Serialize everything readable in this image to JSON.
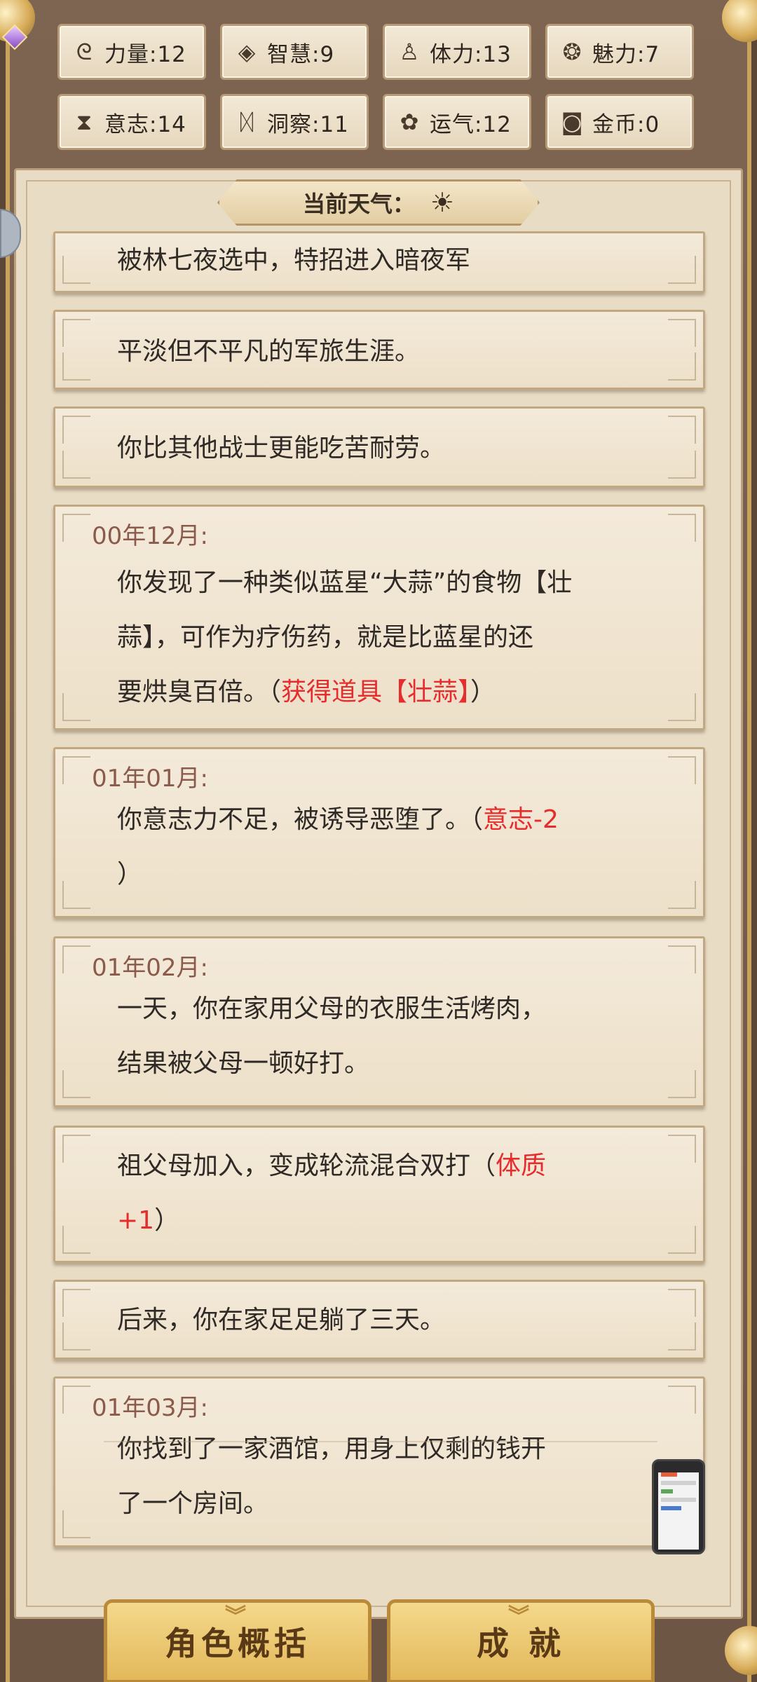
{
  "stats": [
    {
      "icon": "strength-arm-icon",
      "glyph": "ᘓ",
      "label": "力量:12"
    },
    {
      "icon": "wisdom-book-icon",
      "glyph": "◈",
      "label": "智慧:9"
    },
    {
      "icon": "stamina-figure-icon",
      "glyph": "♙",
      "label": "体力:13"
    },
    {
      "icon": "charm-icon",
      "glyph": "❂",
      "label": "魅力:7"
    },
    {
      "icon": "will-hourglass-icon",
      "glyph": "⧗",
      "label": "意志:14"
    },
    {
      "icon": "insight-dragon-icon",
      "glyph": "ᛞ",
      "label": "洞察:11"
    },
    {
      "icon": "luck-flower-icon",
      "glyph": "✿",
      "label": "运气:12"
    },
    {
      "icon": "gold-coin-icon",
      "glyph": "◙",
      "label": "金币:0"
    }
  ],
  "weather": {
    "label": "当前天气：",
    "icon": "sun-icon",
    "glyph": "☀"
  },
  "events": {
    "e0": {
      "text": "被林七夜选中，特招进入暗夜军"
    },
    "e1": {
      "text": "平淡但不平凡的军旅生涯。"
    },
    "e2": {
      "text": "你比其他战士更能吃苦耐劳。"
    },
    "e3": {
      "date": "00年12月:",
      "line1": "你发现了一种类似蓝星“大蒜”的食物【壮",
      "line2": "蒜】，可作为疗伤药，就是比蓝星的还",
      "line3a": "要烘臭百倍。（",
      "line3b": "获得道具【壮蒜】",
      "line3c": "）"
    },
    "e4": {
      "date": "01年01月:",
      "line1a": "你意志力不足，被诱导恶堕了。（",
      "line1b": "意志-2",
      "line2": "）"
    },
    "e5": {
      "date": "01年02月:",
      "line1": "一天，你在家用父母的衣服生活烤肉，",
      "line2": "结果被父母一顿好打。"
    },
    "e6": {
      "line1a": "祖父母加入，变成轮流混合双打（",
      "line1b": "体质",
      "line2a": "+1",
      "line2b": "）"
    },
    "e7": {
      "text": "后来，你在家足足躺了三天。"
    },
    "e8": {
      "date": "01年03月:",
      "line1": "你找到了一家酒馆，用身上仅剩的钱开",
      "line2": "了一个房间。"
    }
  },
  "buttons": {
    "summary": "角色概括",
    "achievements": "成 就",
    "chevron": "︾"
  }
}
